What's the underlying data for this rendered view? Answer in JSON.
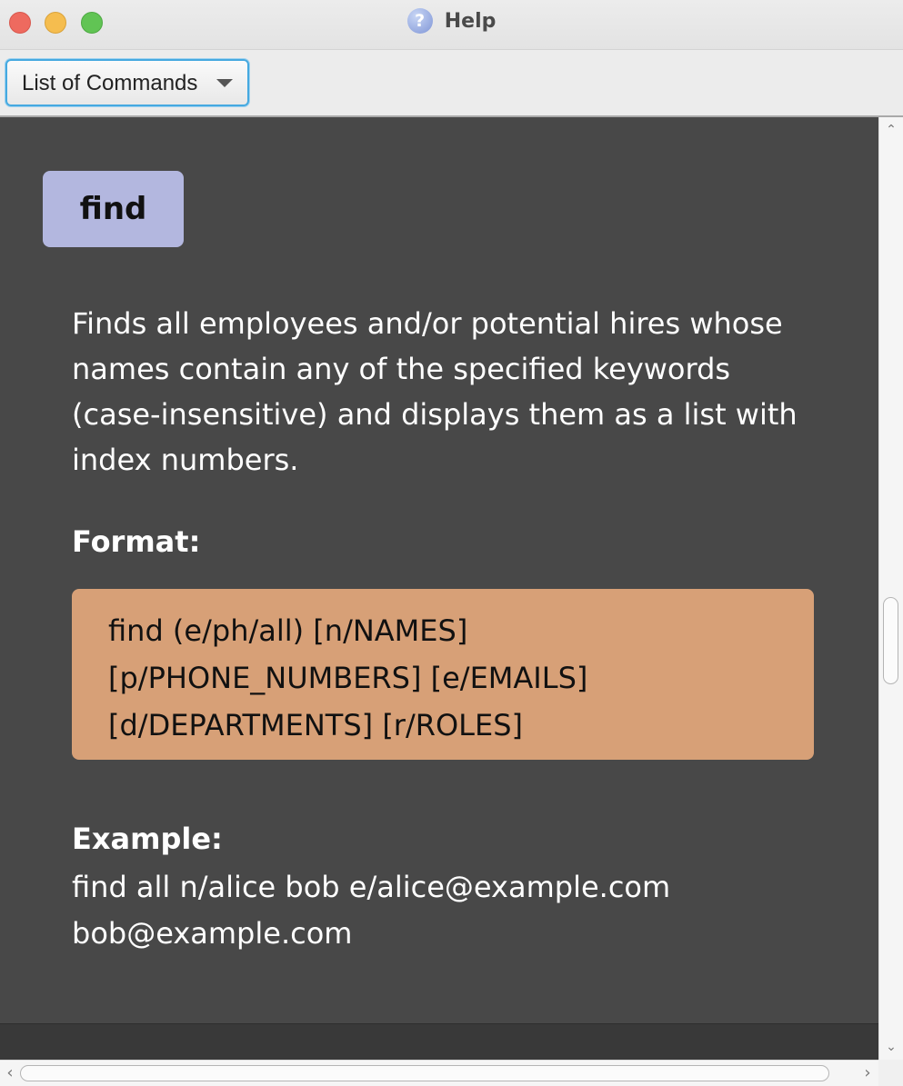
{
  "window": {
    "title": "Help",
    "title_icon": "question-mark-icon",
    "traffic_lights": {
      "close_color": "#ee6a5f",
      "minimize_color": "#f5bd4f",
      "maximize_color": "#61c454"
    }
  },
  "toolbar": {
    "dropdown": {
      "selected": "List of Commands",
      "arrow_icon": "chevron-down-icon",
      "focus_color": "#45a9e0"
    }
  },
  "content": {
    "background": "#484848",
    "command": {
      "name": "find",
      "badge_color": "#b3b7df"
    },
    "description": "Finds all employees and/or potential hires whose names contain any of the specified keywords (case-insensitive) and displays them as a list with index numbers.",
    "format_heading": "Format:",
    "format_lines": [
      "find (e/ph/all) [n/NAMES]",
      "[p/PHONE_NUMBERS] [e/EMAILS]",
      "[d/DEPARTMENTS] [r/ROLES]"
    ],
    "format_box_color": "#d7a077",
    "example_heading": "Example:",
    "example_lines": [
      "find all n/alice bob e/alice@example.com",
      "bob@example.com"
    ]
  },
  "scrollbars": {
    "vertical": {
      "up_icon": "chevron-up-icon",
      "down_icon": "chevron-down-icon"
    },
    "horizontal": {
      "left_icon": "chevron-left-icon",
      "right_icon": "chevron-right-icon"
    }
  }
}
